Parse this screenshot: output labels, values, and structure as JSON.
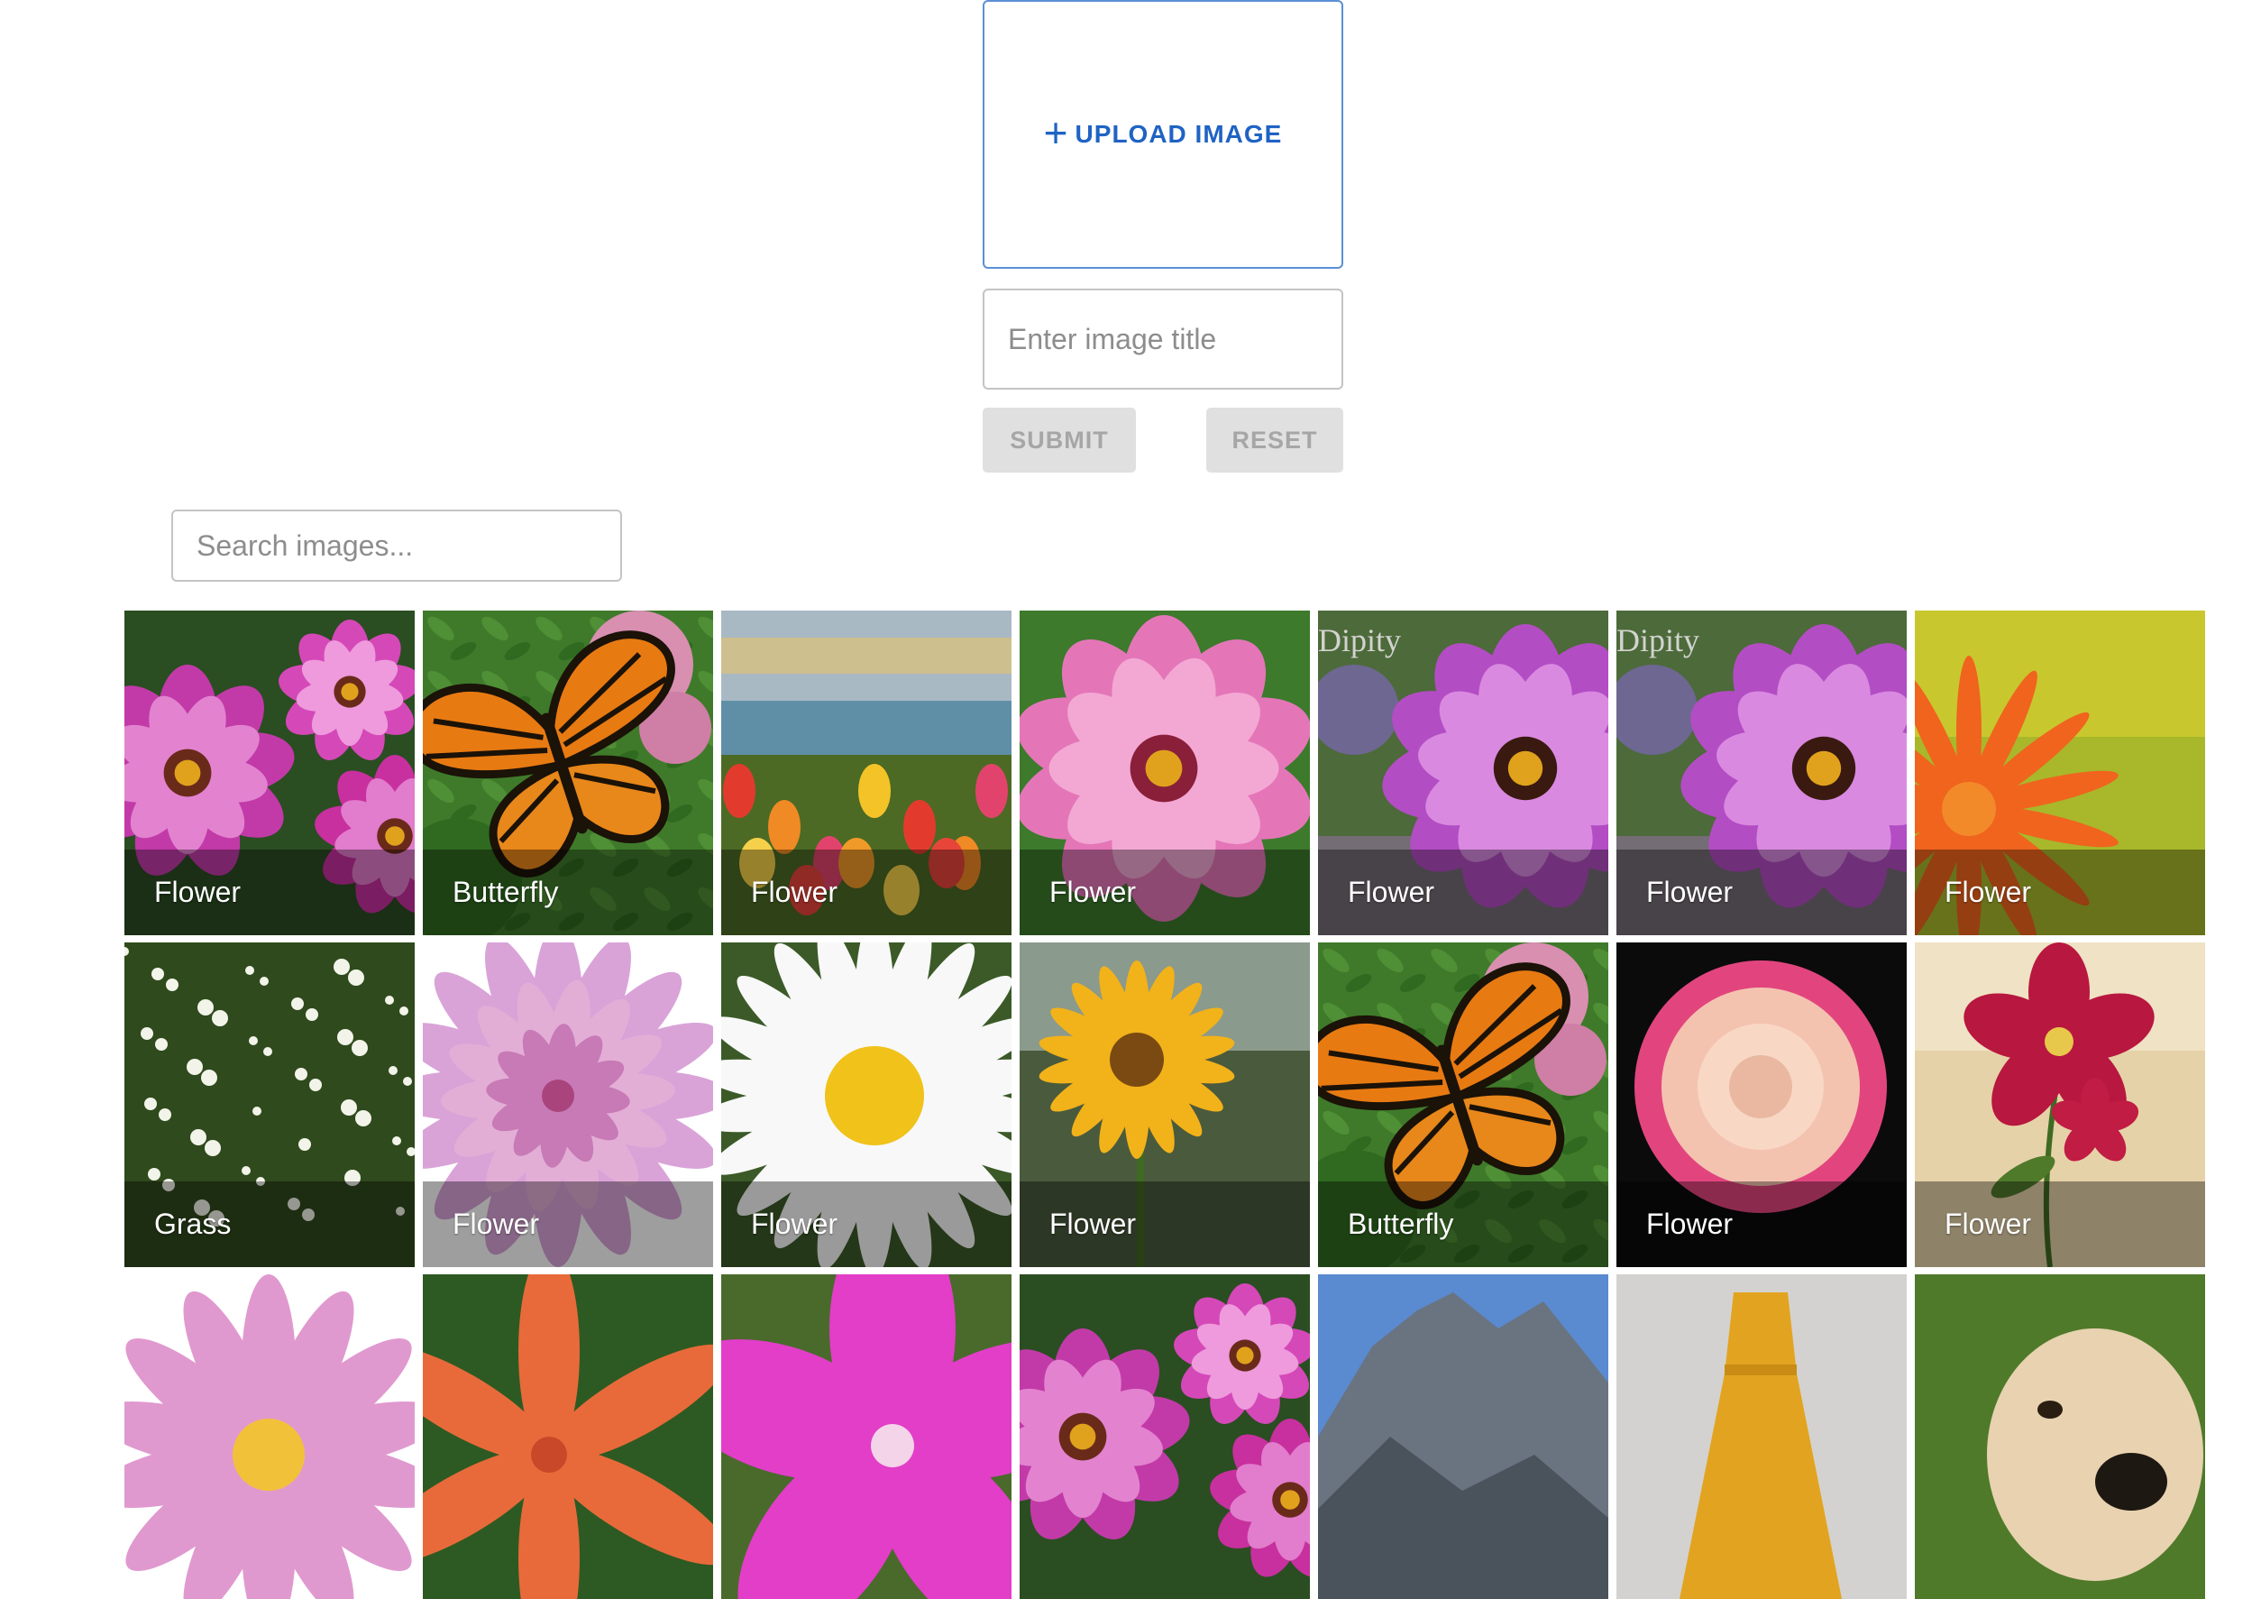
{
  "upload": {
    "label": "UPLOAD IMAGE",
    "icon": "plus-icon"
  },
  "form": {
    "title_placeholder": "Enter image title",
    "submit_label": "SUBMIT",
    "reset_label": "RESET"
  },
  "search": {
    "placeholder": "Search images..."
  },
  "colors": {
    "accent": "#1f63c4",
    "upload_border": "#5b8fd6",
    "button_bg": "#e0e0e0",
    "button_text": "#a6a6a6"
  },
  "gallery": [
    {
      "caption": "Flower",
      "subject": "magenta-dahlias"
    },
    {
      "caption": "Butterfly",
      "subject": "monarch-butterfly"
    },
    {
      "caption": "Flower",
      "subject": "tulips-by-lake"
    },
    {
      "caption": "Flower",
      "subject": "pink-dahlia"
    },
    {
      "caption": "Flower",
      "subject": "purple-dahlia",
      "watermark": "Dipity"
    },
    {
      "caption": "Flower",
      "subject": "purple-dahlia",
      "watermark": "Dipity"
    },
    {
      "caption": "Flower",
      "subject": "orange-daisy"
    },
    {
      "caption": "Grass",
      "subject": "white-wildflowers"
    },
    {
      "caption": "Flower",
      "subject": "lilac-dahlia"
    },
    {
      "caption": "Flower",
      "subject": "white-daisy"
    },
    {
      "caption": "Flower",
      "subject": "sunflower"
    },
    {
      "caption": "Butterfly",
      "subject": "monarch-butterfly"
    },
    {
      "caption": "Flower",
      "subject": "peach-rose"
    },
    {
      "caption": "Flower",
      "subject": "red-flower-painting"
    },
    {
      "caption": "",
      "subject": "pink-daisy"
    },
    {
      "caption": "",
      "subject": "orange-lily"
    },
    {
      "caption": "",
      "subject": "magenta-petals"
    },
    {
      "caption": "",
      "subject": "magenta-dahlias"
    },
    {
      "caption": "",
      "subject": "mountain"
    },
    {
      "caption": "",
      "subject": "yellow-dress"
    },
    {
      "caption": "",
      "subject": "dog"
    }
  ]
}
